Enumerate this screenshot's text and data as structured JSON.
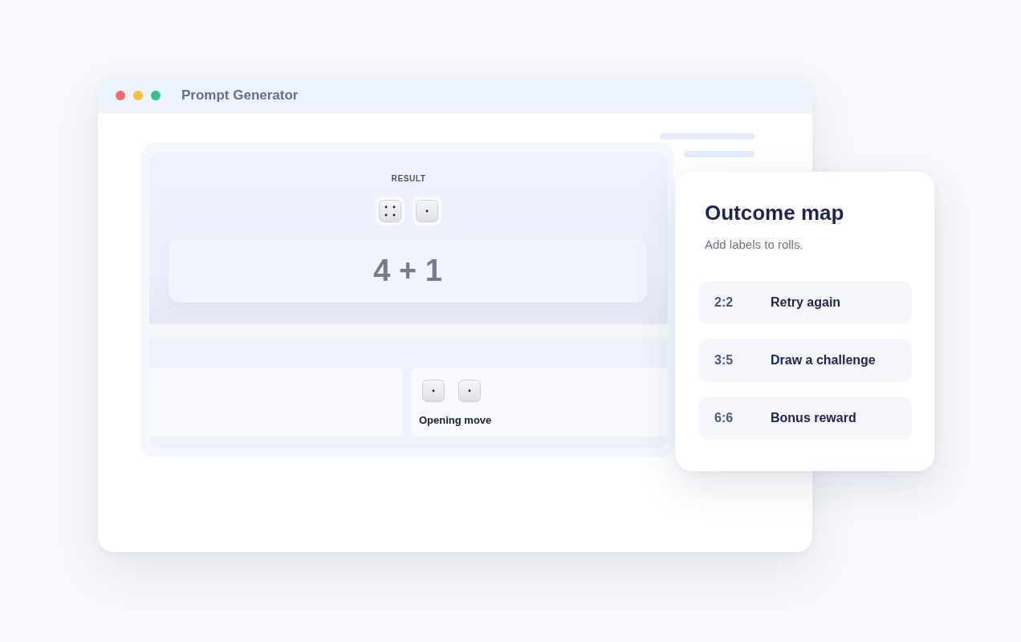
{
  "window": {
    "title": "Prompt Generator",
    "controls": [
      {
        "color": "#f26b6b"
      },
      {
        "color": "#fbbc41"
      },
      {
        "color": "#35c08a"
      }
    ]
  },
  "result": {
    "label": "RESULT",
    "dice": [
      {
        "kind": "four"
      },
      {
        "kind": "one"
      }
    ],
    "sum": "4 + 1"
  },
  "history": {
    "cards": [
      {
        "dice": [
          {
            "kind": "one"
          },
          {
            "kind": "one"
          }
        ],
        "title": "Opening move"
      }
    ]
  },
  "outcome_map": {
    "title": "Outcome map",
    "subtitle": "Add labels to rolls.",
    "rows": [
      {
        "roll": "2:2",
        "label": "Retry again"
      },
      {
        "roll": "3:5",
        "label": "Draw a challenge"
      },
      {
        "roll": "6:6",
        "label": "Bonus reward"
      }
    ]
  }
}
